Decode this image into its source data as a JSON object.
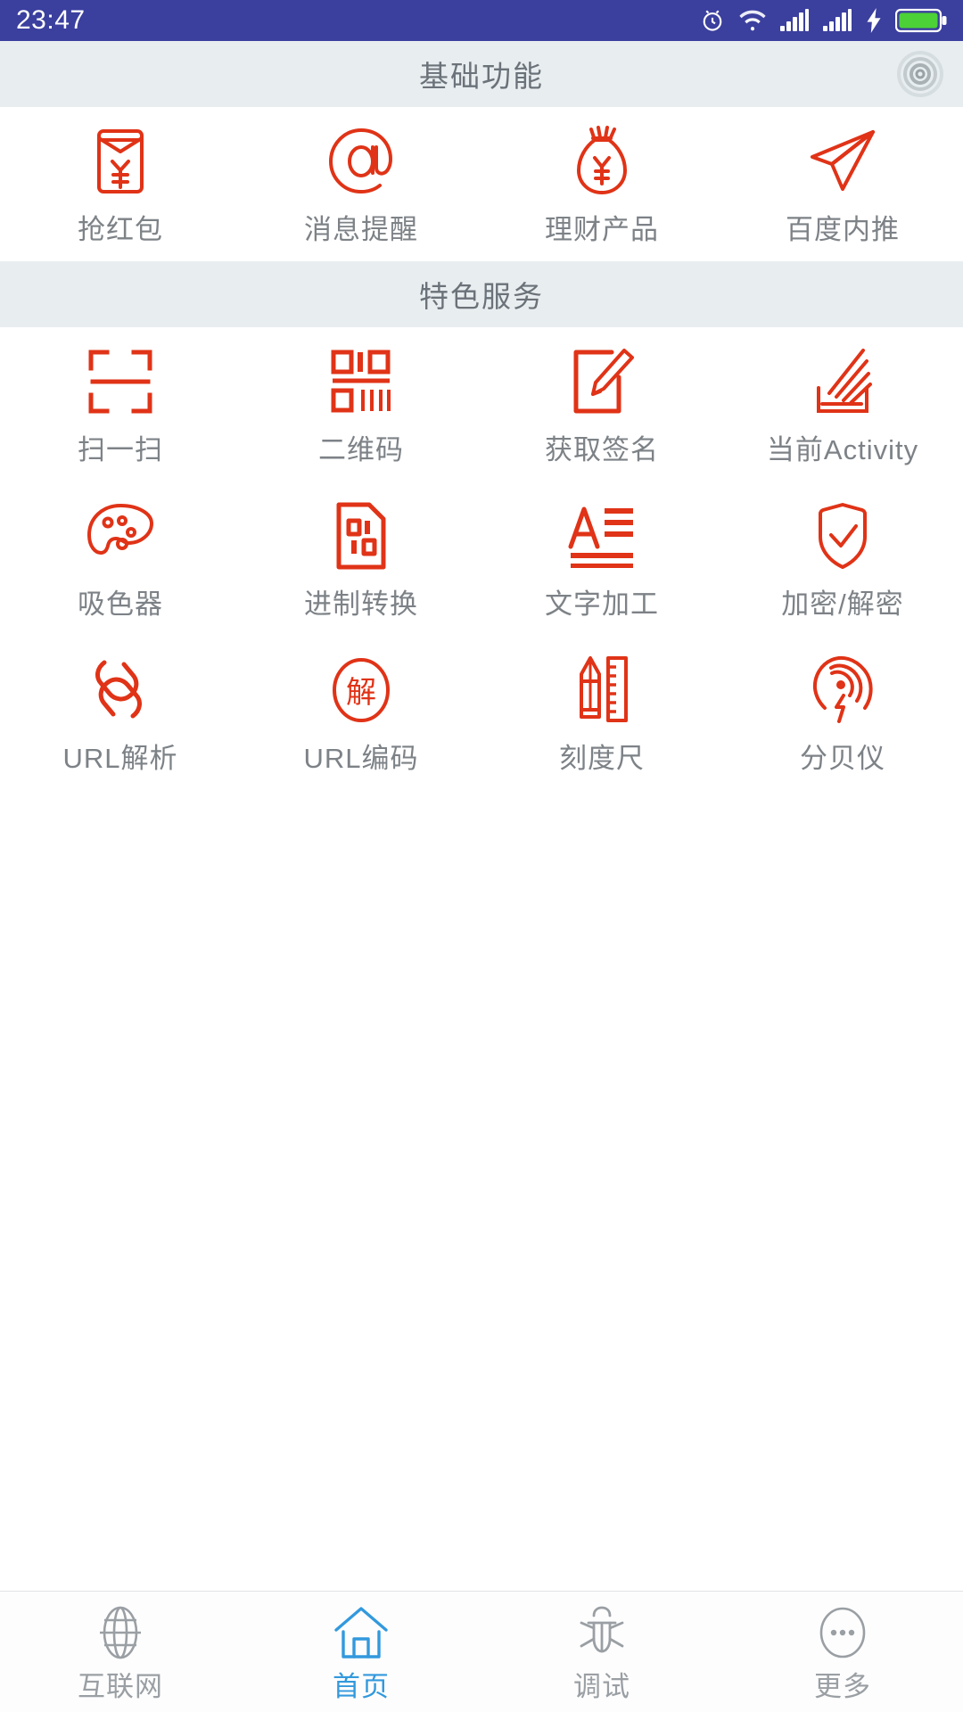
{
  "status_bar": {
    "time": "23:47",
    "icons": [
      "alarm-clock-icon",
      "wifi-icon",
      "signal-bars-icon",
      "signal-bars-icon",
      "charging-bolt-icon",
      "battery-icon"
    ],
    "background_color": "#3b3f9e",
    "foreground_color": "#ffffff"
  },
  "theme": {
    "accent_red": "#e03317",
    "label_gray": "#7d8287",
    "header_bg": "#e8eef0",
    "header_text": "#6b7279",
    "active_blue": "#3399dd",
    "inactive_gray": "#9a9fa4"
  },
  "sections": [
    {
      "title": "基础功能",
      "right_icon": "target-bullseye-icon",
      "items": [
        {
          "label": "抢红包",
          "icon": "red-envelope-yuan-icon"
        },
        {
          "label": "消息提醒",
          "icon": "at-sign-icon"
        },
        {
          "label": "理财产品",
          "icon": "money-bag-yuan-icon"
        },
        {
          "label": "百度内推",
          "icon": "paper-plane-send-icon"
        }
      ]
    },
    {
      "title": "特色服务",
      "right_icon": null,
      "items": [
        {
          "label": "扫一扫",
          "icon": "scan-frame-icon"
        },
        {
          "label": "二维码",
          "icon": "qr-code-icon"
        },
        {
          "label": "获取签名",
          "icon": "signature-pencil-icon"
        },
        {
          "label": "当前Activity",
          "icon": "activity-stack-icon"
        },
        {
          "label": "吸色器",
          "icon": "color-palette-icon"
        },
        {
          "label": "进制转换",
          "icon": "binary-document-icon"
        },
        {
          "label": "文字加工",
          "icon": "text-lines-a-icon"
        },
        {
          "label": "加密/解密",
          "icon": "shield-check-icon"
        },
        {
          "label": "URL解析",
          "icon": "chain-link-icon"
        },
        {
          "label": "URL编码",
          "icon": "circled-jie-icon"
        },
        {
          "label": "刻度尺",
          "icon": "pencil-ruler-icon"
        },
        {
          "label": "分贝仪",
          "icon": "decibel-wave-icon"
        }
      ]
    }
  ],
  "tabbar": {
    "active_index": 1,
    "tabs": [
      {
        "label": "互联网",
        "icon": "globe-icon"
      },
      {
        "label": "首页",
        "icon": "home-icon"
      },
      {
        "label": "调试",
        "icon": "bug-icon"
      },
      {
        "label": "更多",
        "icon": "ellipsis-circle-icon"
      }
    ]
  }
}
